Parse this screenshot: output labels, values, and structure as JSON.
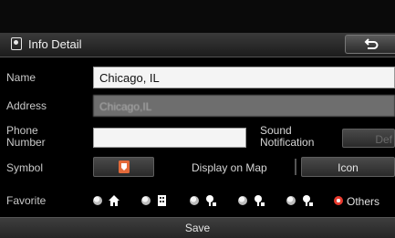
{
  "header": {
    "title": "Info Detail",
    "back_icon": "back-arrow-icon"
  },
  "form": {
    "name_label": "Name",
    "name_value": "Chicago, IL",
    "address_label": "Address",
    "address_value": "Chicago,IL",
    "phone_label": "Phone Number",
    "phone_value": "",
    "sound_label": "Sound Notification",
    "sound_button": "Def",
    "symbol_label": "Symbol",
    "display_label": "Display on Map",
    "display_button": "Icon",
    "favorite_label": "Favorite",
    "favorites": [
      {
        "icon": "home-icon",
        "selected": false
      },
      {
        "icon": "office-icon",
        "selected": false
      },
      {
        "icon": "pin-1-icon",
        "selected": false
      },
      {
        "icon": "pin-2-icon",
        "selected": false
      },
      {
        "icon": "pin-3-icon",
        "selected": false
      },
      {
        "label": "Others",
        "selected": true
      }
    ]
  },
  "save_label": "Save",
  "colors": {
    "accent": "#e83a2e",
    "field": "#f4f4f4",
    "disabled": "#6e6e6e"
  }
}
